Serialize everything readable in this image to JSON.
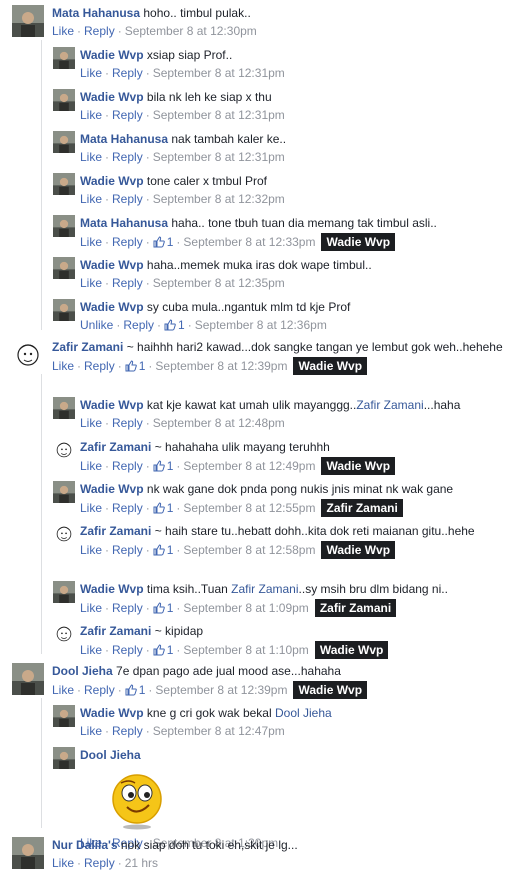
{
  "actions": {
    "like": "Like",
    "unlike": "Unlike",
    "reply": "Reply",
    "sep": "·"
  },
  "colors": {
    "name": "#365899",
    "meta": "#90949c",
    "tooltip": "#1c1e21"
  },
  "comments": [
    {
      "id": "c1",
      "level": 0,
      "author": "Mata Hahanusa",
      "text": "hoho.. timbul pulak..",
      "time": "September 8 at 12:30pm",
      "likes": "",
      "avatar": "photo-avatar"
    },
    {
      "id": "c2",
      "level": 1,
      "author": "Wadie Wvp",
      "text": "xsiap siap Prof..",
      "time": "September 8 at 12:31pm",
      "likes": "",
      "avatar": "photo-avatar"
    },
    {
      "id": "c3",
      "level": 1,
      "author": "Wadie Wvp",
      "text": "bila nk leh ke siap x thu",
      "time": "September 8 at 12:31pm",
      "likes": "",
      "avatar": "photo-avatar"
    },
    {
      "id": "c4",
      "level": 1,
      "author": "Mata Hahanusa",
      "text": "nak tambah kaler ke..",
      "time": "September 8 at 12:31pm",
      "likes": "",
      "avatar": "photo-avatar"
    },
    {
      "id": "c5",
      "level": 1,
      "author": "Wadie Wvp",
      "text": "tone caler x tmbul Prof",
      "time": "September 8 at 12:32pm",
      "likes": "",
      "avatar": "photo-avatar"
    },
    {
      "id": "c6",
      "level": 1,
      "author": "Mata Hahanusa",
      "text": "haha.. tone tbuh tuan dia memang tak timbul asli..",
      "time": "September 8 at 12:33pm",
      "likes": "1",
      "tooltip": "Wadie Wvp",
      "avatar": "photo-avatar"
    },
    {
      "id": "c7",
      "level": 1,
      "author": "Wadie Wvp",
      "text": "haha..memek muka iras dok wape timbul..",
      "time": "September 8 at 12:35pm",
      "likes": "",
      "avatar": "photo-avatar"
    },
    {
      "id": "c8",
      "level": 1,
      "author": "Wadie Wvp",
      "text": "sy cuba mula..ngantuk mlm td kje Prof",
      "time": "September 8 at 12:36pm",
      "likes": "1",
      "liked": true,
      "avatar": "photo-avatar"
    },
    {
      "id": "c9",
      "level": 0,
      "author": "Zafir Zamani",
      "text": "~ haihhh hari2 kawad...dok sangke tangan ye lembut gok weh..hehehe",
      "time": "September 8 at 12:39pm",
      "likes": "1",
      "tooltip": "Wadie Wvp",
      "avatar": "sketch-avatar"
    },
    {
      "id": "c10",
      "level": 1,
      "author": "Wadie Wvp",
      "text": "kat kje kawat kat umah ulik mayanggg..",
      "mention": "Zafir Zamani",
      "after": "...haha",
      "time": "September 8 at 12:48pm",
      "likes": "",
      "avatar": "photo-avatar"
    },
    {
      "id": "c11",
      "level": 1,
      "author": "Zafir Zamani",
      "text": "~ hahahaha ulik mayang teruhhh",
      "time": "September 8 at 12:49pm",
      "likes": "1",
      "tooltip": "Wadie Wvp",
      "avatar": "sketch-avatar"
    },
    {
      "id": "c12",
      "level": 1,
      "author": "Wadie Wvp",
      "text": "nk wak gane dok pnda pong nukis jnis minat nk wak gane",
      "time": "September 8 at 12:55pm",
      "likes": "1",
      "tooltip": "Zafir Zamani",
      "avatar": "photo-avatar"
    },
    {
      "id": "c13",
      "level": 1,
      "author": "Zafir Zamani",
      "text": "~ haih stare tu..hebatt dohh..kita dok reti maianan gitu..hehe",
      "time": "September 8 at 12:58pm",
      "likes": "1",
      "tooltip": "Wadie Wvp",
      "avatar": "sketch-avatar"
    },
    {
      "id": "c14",
      "level": 1,
      "author": "Wadie Wvp",
      "text": "tima ksih..Tuan",
      "mention": "Zafir Zamani",
      "after": "..sy msih bru dlm bidang ni..",
      "time": "September 8 at 1:09pm",
      "likes": "1",
      "tooltip": "Zafir Zamani",
      "avatar": "photo-avatar"
    },
    {
      "id": "c15",
      "level": 1,
      "author": "Zafir Zamani",
      "text": "~ kipidap",
      "time": "September 8 at 1:10pm",
      "likes": "1",
      "tooltip": "Wadie Wvp",
      "avatar": "sketch-avatar"
    },
    {
      "id": "c16",
      "level": 0,
      "author": "Dool Jieha",
      "text": "7e dpan pago ade jual mood ase...hahaha",
      "time": "September 8 at 12:39pm",
      "likes": "1",
      "tooltip": "Wadie Wvp",
      "avatar": "photo-avatar"
    },
    {
      "id": "c17",
      "level": 1,
      "author": "Wadie Wvp",
      "text": "kne g cri gok wak bekal",
      "mention": "Dool Jieha",
      "after": "",
      "time": "September 8 at 12:47pm",
      "likes": "",
      "avatar": "photo-avatar"
    },
    {
      "id": "c18",
      "level": 1,
      "author": "Dool Jieha",
      "text": "",
      "sticker": "smiley-sticker",
      "time": "September 8 at 1:30pm",
      "likes": "",
      "avatar": "photo-avatar"
    },
    {
      "id": "c19",
      "level": 0,
      "author": "Nur Dalila's",
      "text": "nok siap doh tu toki eh,skit je lg...",
      "time": "21 hrs",
      "likes": "",
      "avatar": "photo-avatar"
    }
  ]
}
